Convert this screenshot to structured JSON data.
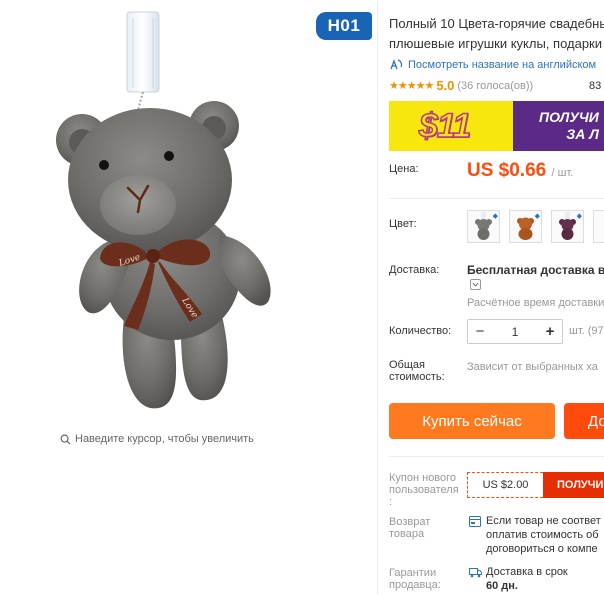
{
  "gallery": {
    "model_badge": "H01",
    "zoom_hint": "Наведите курсор, чтобы увеличить",
    "ribbon_text": "Love"
  },
  "product": {
    "title_line1": "Полный 10 Цвета-горячие свадебные",
    "title_line2": "плюшевые игрушки куклы, подарки",
    "translate_link": "Посмотреть название на английском",
    "rating_stars": "★★★★★",
    "rating_value": "5.0",
    "votes": "(36 голоса(ов))",
    "orders": "83",
    "promo": {
      "amount": "$11",
      "text_line1": "ПОЛУЧИ",
      "text_line2": "ЗА Л"
    },
    "price_label": "Цена:",
    "price": "US $0.66",
    "price_unit": "/ шт.",
    "color_label": "Цвет:",
    "colors": [
      "grey-bear",
      "brown-bear",
      "purple-bear"
    ],
    "shipping_label": "Доставка:",
    "shipping_title": "Бесплатная доставка в Р",
    "shipping_eta": "Расчётное время доставки",
    "quantity_label": "Количество:",
    "quantity": "1",
    "quantity_minus": "−",
    "quantity_plus": "+",
    "stock": "шт. (97",
    "total_label_line1": "Общая",
    "total_label_line2": "стоимость:",
    "total_note": "Зависит от выбранных ха",
    "buy_now": "Купить сейчас",
    "add_to_cart": "До",
    "coupon_label_line1": "Купон нового",
    "coupon_label_line2": "пользователя",
    "coupon_label_line3": ":",
    "coupon_amount": "US $2.00",
    "coupon_get": "ПОЛУЧИ",
    "return_label_line1": "Возврат",
    "return_label_line2": "товара",
    "return_line1": "Если товар не соответ",
    "return_line2": "оплатив стоимость об",
    "return_line3": "договориться о компе",
    "guarantee_label_line1": "Гарантии",
    "guarantee_label_line2": "продавца:",
    "delivery_line1": "Доставка в срок",
    "delivery_line2": "60 дн."
  },
  "colors": {
    "accent": "#ff4c0c",
    "buy_button": "#ff7a1f",
    "badge": "#1a64b5",
    "link": "#2a73c6",
    "star": "#f19100",
    "promo_bg": "#5b2a86",
    "promo_yellow": "#f7e70c"
  }
}
